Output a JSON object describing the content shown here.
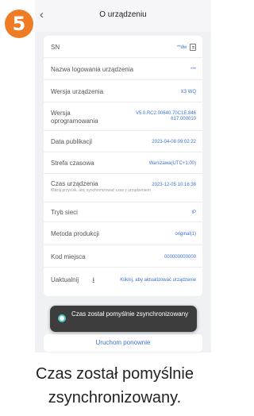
{
  "step": {
    "number": "5"
  },
  "header": {
    "title": "O urządzeniu",
    "back_icon": "close-icon"
  },
  "rows": [
    {
      "label": "SN",
      "value": "**dw",
      "icon": "copy-icon"
    },
    {
      "label": "Nazwa logowania urządzenia",
      "value": "***"
    },
    {
      "label": "Wersja urządzenia",
      "value": "X3 WQ"
    },
    {
      "label": "Wersja oprogramowania",
      "value": "V5.0.RC2.00640.70C1E.846 617.000010"
    },
    {
      "label": "Data publikacji",
      "value": "2023-04-08 09:02:22"
    },
    {
      "label": "Strefa czasowa",
      "value": "Warszawa(UTC+1:00)"
    },
    {
      "label": "Czas urządzenia",
      "value": "2023-12-05 10:16:38",
      "hint": "Kliknij przycisk, aby synchronizować czas z urządzeniem"
    },
    {
      "label": "Tryb sieci",
      "value": "IP"
    },
    {
      "label": "Metoda produkcji",
      "value": "original(1)"
    },
    {
      "label": "Kod miejsca",
      "value": "000000000000"
    },
    {
      "label": "Uaktualnij",
      "value": "Kliknij, aby aktualizować urządzenie",
      "icon": "upload-icon"
    }
  ],
  "toast": {
    "text": "Czas został pomyślnie zsynchronizowany",
    "icon": "check-circle-icon"
  },
  "restart_button": {
    "label": "Uruchom ponownie"
  },
  "caption": {
    "text": "Czas został pomyślnie zsynchronizowany."
  },
  "colors": {
    "accent": "#3a72d1",
    "badge": "#ef7b25",
    "toast_bg": "#3d3d3d"
  }
}
